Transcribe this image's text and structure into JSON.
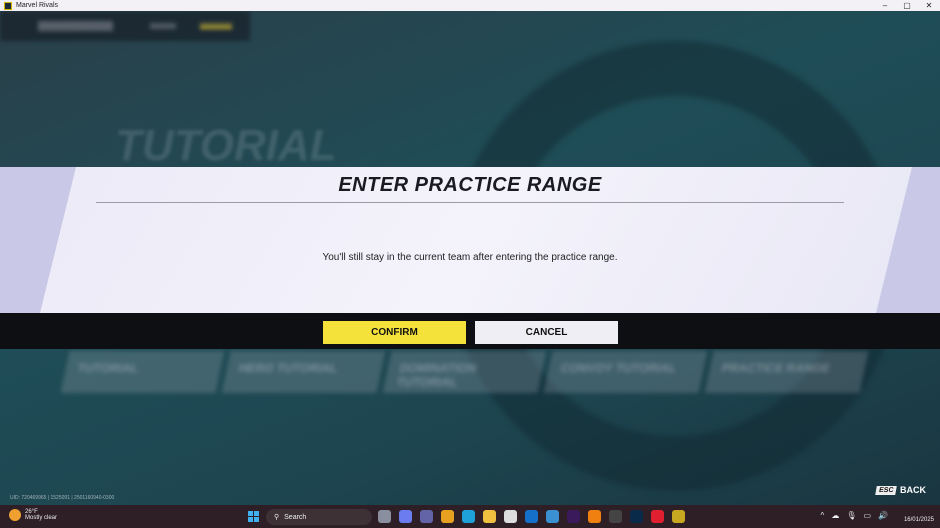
{
  "window": {
    "title": "Marvel Rivals",
    "minimize": "–",
    "maximize": "▢",
    "close": "✕"
  },
  "background": {
    "title": "TUTORIAL",
    "cards": [
      "TUTORIAL",
      "HERO TUTORIAL",
      "DOMINATION TUTORIAL",
      "CONVOY TUTORIAL",
      "PRACTICE RANGE"
    ]
  },
  "dialog": {
    "title": "ENTER PRACTICE RANGE",
    "message": "You'll still stay in the current team after entering the practice range.",
    "confirm": "CONFIRM",
    "cancel": "CANCEL"
  },
  "uid": "UID: 720469965 | 1525091 | 2501160940-0300",
  "back": {
    "key": "ESC",
    "label": "BACK"
  },
  "taskbar": {
    "temperature": "26°F",
    "weather": "Mostly clear",
    "search_placeholder": "Search",
    "date": "16/01/2025",
    "apps": [
      {
        "name": "task-view",
        "color": "#8a8fa0"
      },
      {
        "name": "copilot",
        "color": "#6a7cf0"
      },
      {
        "name": "teams",
        "color": "#6264a7"
      },
      {
        "name": "chrome",
        "color": "#e8a020"
      },
      {
        "name": "edge",
        "color": "#1ea0d8"
      },
      {
        "name": "file-explorer",
        "color": "#f0c040"
      },
      {
        "name": "store",
        "color": "#ddd"
      },
      {
        "name": "outlook",
        "color": "#1470c8"
      },
      {
        "name": "photos",
        "color": "#3a90d0"
      },
      {
        "name": "premiere",
        "color": "#3a1a5a"
      },
      {
        "name": "vlc",
        "color": "#f08010"
      },
      {
        "name": "obs",
        "color": "#444"
      },
      {
        "name": "photoshop",
        "color": "#0a2a4a"
      },
      {
        "name": "app-red",
        "color": "#e02030"
      },
      {
        "name": "marvel-rivals",
        "color": "#c8a820"
      }
    ]
  }
}
